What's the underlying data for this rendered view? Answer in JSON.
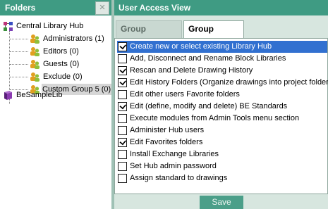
{
  "left_panel": {
    "title": "Folders",
    "close_glyph": "×",
    "tree": {
      "root_label": "Central Library Hub",
      "groups": [
        {
          "label": "Administrators (1)"
        },
        {
          "label": "Editors (0)"
        },
        {
          "label": "Guests (0)"
        },
        {
          "label": "Exclude (0)"
        },
        {
          "label": "Custom Group 5 (0)"
        }
      ],
      "library_label": "BeSampleLib"
    }
  },
  "right_panel": {
    "title": "User Access View",
    "tabs": [
      {
        "label": "Group Members",
        "active": false
      },
      {
        "label": "Group Rights",
        "active": true
      }
    ],
    "rights": [
      {
        "label": "Create new or select existing Library Hub",
        "checked": true
      },
      {
        "label": "Add, Disconnect and Rename Block Libraries",
        "checked": false
      },
      {
        "label": "Rescan and Delete Drawing History",
        "checked": true
      },
      {
        "label": "Edit History Folders (Organize drawings into project folders)",
        "checked": true
      },
      {
        "label": "Edit other users Favorite folders",
        "checked": false
      },
      {
        "label": "Edit (define, modify and delete) BE Standards",
        "checked": true
      },
      {
        "label": "Execute modules from Admin Tools menu section",
        "checked": false
      },
      {
        "label": "Administer Hub users",
        "checked": false
      },
      {
        "label": "Edit Favorites folders",
        "checked": true
      },
      {
        "label": "Install Exchange Libraries",
        "checked": false
      },
      {
        "label": "Set Hub admin password",
        "checked": false
      },
      {
        "label": "Assign standard to drawings",
        "checked": false
      }
    ],
    "save_label": "Save"
  },
  "colors": {
    "header_bg": "#3f9b83",
    "selection_bg": "#3170d0",
    "workspace_bg": "#d7e6df"
  }
}
